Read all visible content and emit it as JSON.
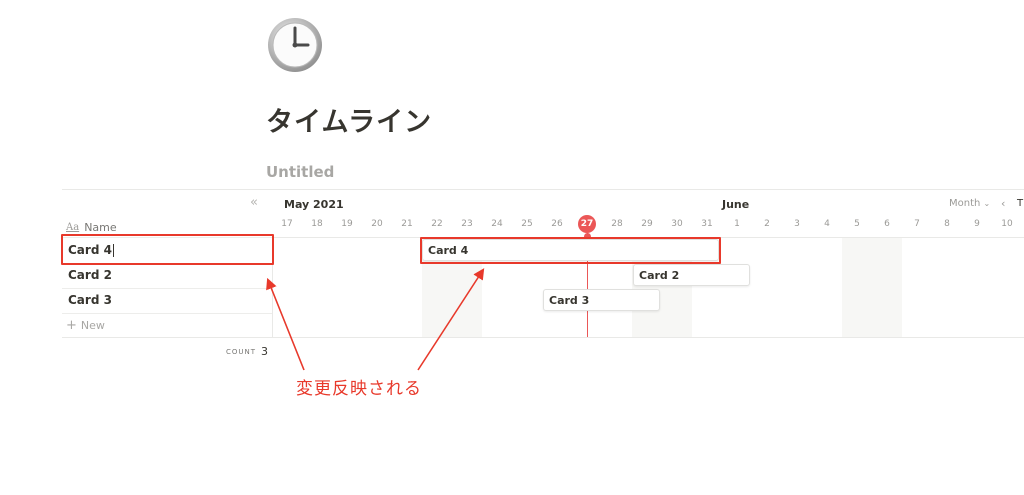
{
  "page": {
    "title": "タイムライン",
    "view_name": "Untitled",
    "icon": "clock-icon"
  },
  "table": {
    "collapse_icon": "«",
    "name_header_icon": "Aa",
    "name_header": "Name",
    "rows": [
      {
        "label": "Card 4"
      },
      {
        "label": "Card 2"
      },
      {
        "label": "Card 3"
      }
    ],
    "new_label": "New",
    "count_label": "COUNT",
    "count_value": "3"
  },
  "timeline": {
    "month_primary": "May 2021",
    "month_secondary": "June",
    "days": [
      "17",
      "18",
      "19",
      "20",
      "21",
      "22",
      "23",
      "24",
      "25",
      "26",
      "27",
      "28",
      "29",
      "30",
      "31",
      "1",
      "2",
      "3",
      "4",
      "5",
      "6",
      "7",
      "8",
      "9",
      "10"
    ],
    "today": "27",
    "scale_selector": "Month",
    "prev_icon": "‹",
    "today_button": "T",
    "cards": [
      {
        "label": "Card 4"
      },
      {
        "label": "Card 2"
      },
      {
        "label": "Card 3"
      }
    ]
  },
  "annotation": {
    "text": "変更反映される",
    "color": "#e8392b"
  },
  "colors": {
    "accent_today": "#eb5757",
    "text": "#37352f",
    "muted": "#9b9a97"
  }
}
